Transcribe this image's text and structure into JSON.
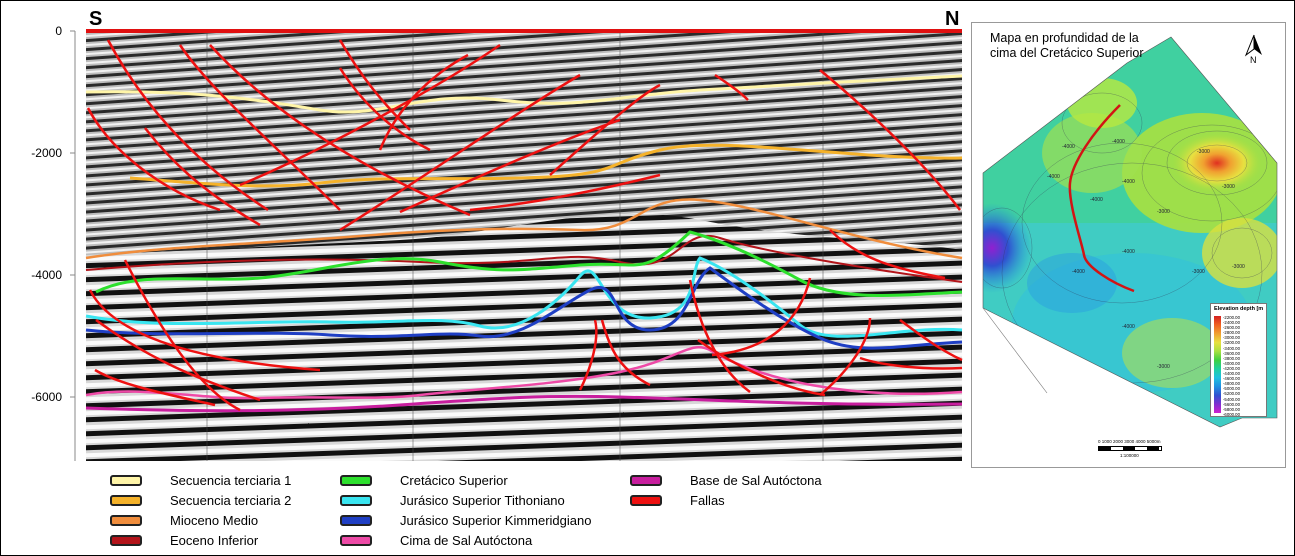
{
  "section": {
    "left_label": "S",
    "right_label": "N",
    "depth_ticks": [
      "0",
      "-2000",
      "-4000",
      "-6000"
    ]
  },
  "legend": [
    {
      "label": "Secuencia terciaria 1",
      "color": "#fff5a8"
    },
    {
      "label": "Secuencia terciaria 2",
      "color": "#f5b22a"
    },
    {
      "label": "Mioceno Medio",
      "color": "#f08d3c"
    },
    {
      "label": "Eoceno Inferior",
      "color": "#b3141a"
    },
    {
      "label": "Cretácico Superior",
      "color": "#2de02d"
    },
    {
      "label": "Jurásico Superior Tithoniano",
      "color": "#39e5f0"
    },
    {
      "label": "Jurásico Superior Kimmeridgiano",
      "color": "#1f3fc4"
    },
    {
      "label": "Cima de Sal Autóctona",
      "color": "#ee4aa7"
    },
    {
      "label": "Base de Sal Autóctona",
      "color": "#c81e9e"
    },
    {
      "label": "Fallas",
      "color": "#ee1111"
    }
  ],
  "map": {
    "title": "Mapa en profundidad de la cima del Cretácico Superior",
    "north_letter": "N",
    "colorbar_title": "Elevation depth [m",
    "colorbar_values": [
      "-2200.00",
      "-2400.00",
      "-2600.00",
      "-2800.00",
      "-3000.00",
      "-3200.00",
      "-3400.00",
      "-3600.00",
      "-3800.00",
      "-4000.00",
      "-4200.00",
      "-4400.00",
      "-4600.00",
      "-4800.00",
      "-5000.00",
      "-5200.00",
      "-5400.00",
      "-5600.00",
      "-5800.00",
      "-6000.00"
    ],
    "contour_labels": [
      "-4000",
      "-4000",
      "-4000",
      "-3000",
      "-3000",
      "-3000",
      "-4000",
      "-4000",
      "-3000",
      "-4000",
      "-4000",
      "-3000",
      "-4000",
      "-3000"
    ],
    "scale_numbers": "0   1000 2000 3000 4000 5000m",
    "scale_ratio": "1:100000"
  }
}
